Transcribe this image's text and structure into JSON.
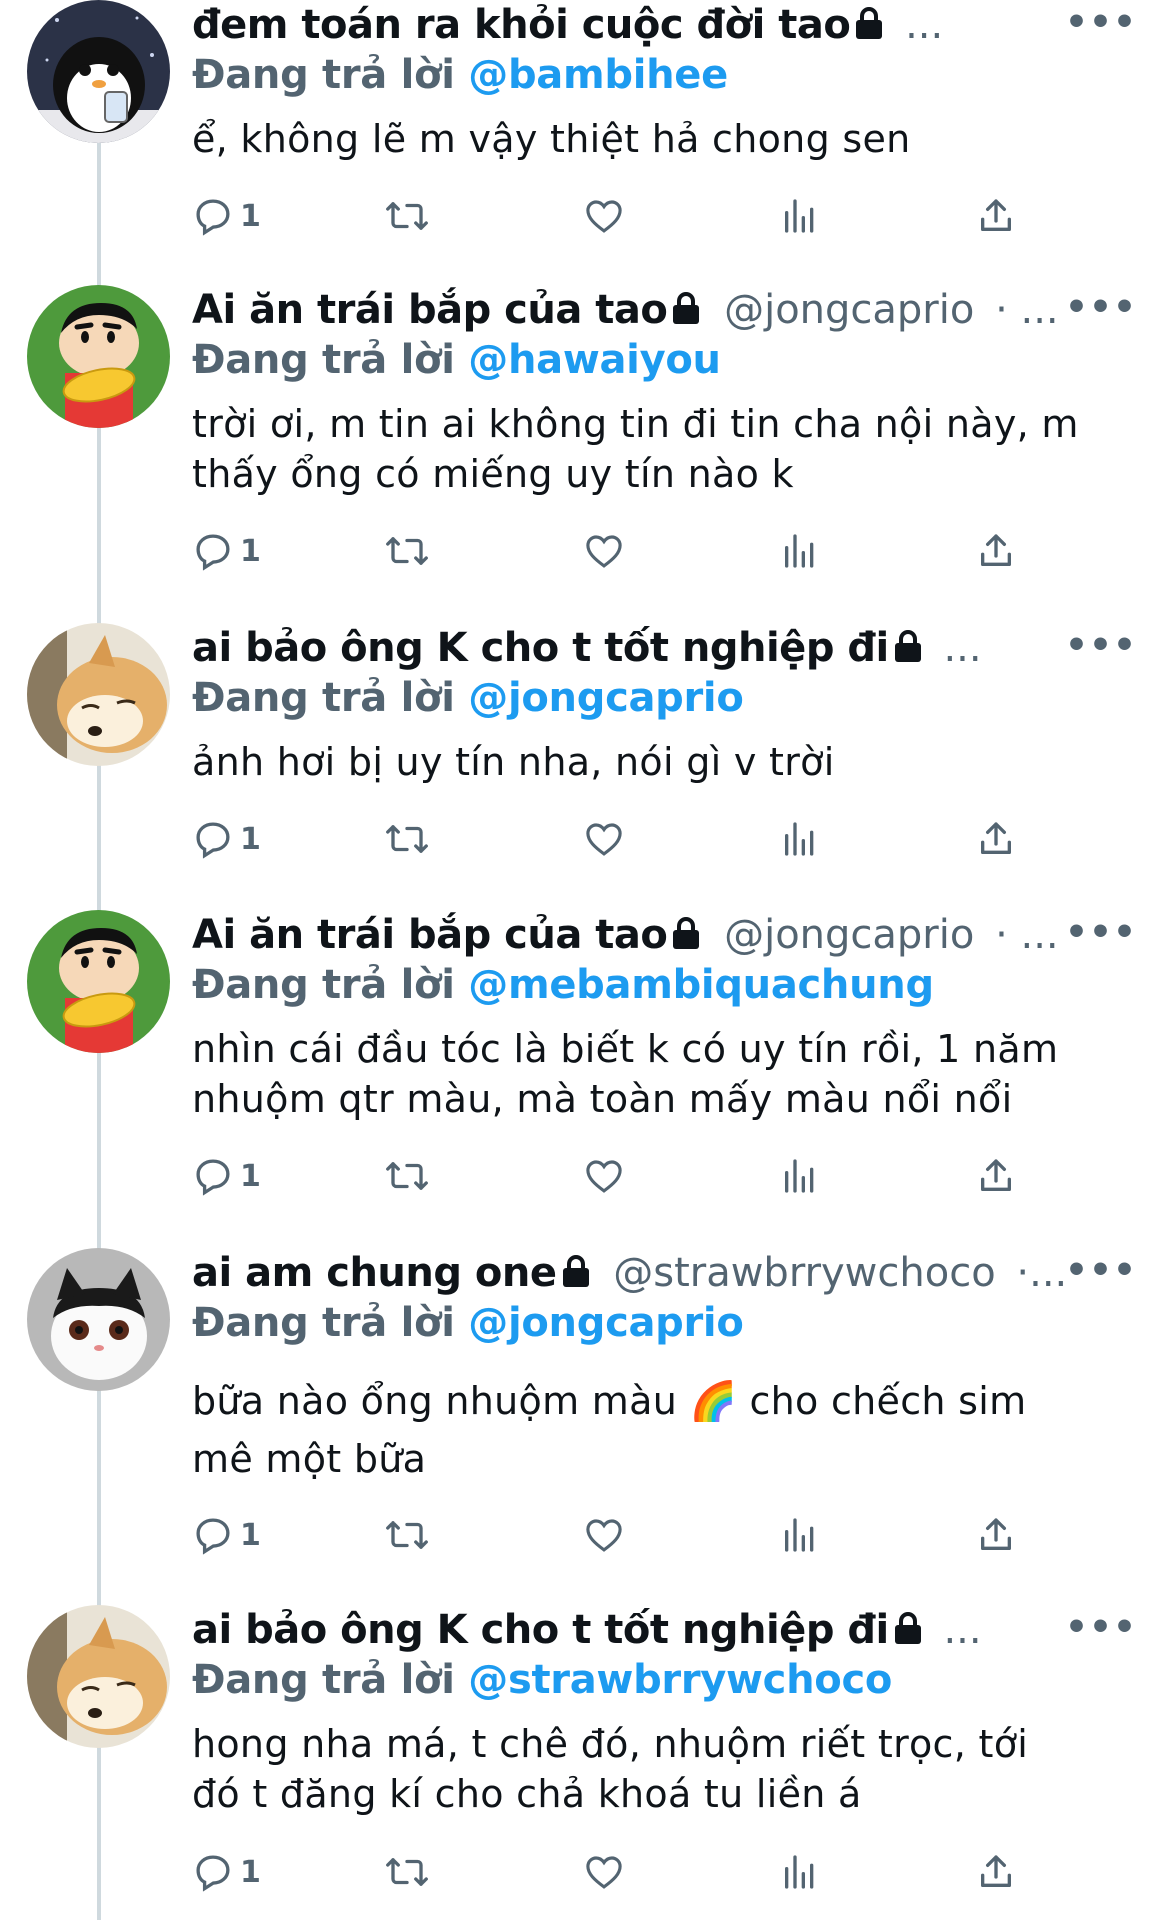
{
  "thread": {
    "tweets": [
      {
        "name": "đem toán ra khỏi cuộc đời tao",
        "handle": "",
        "trail": "...",
        "replying_prefix": "Đang trả lời",
        "replying_to": "@bambihee",
        "lines": [
          "ể, không lẽ m vậy thiệt hả chong sen"
        ],
        "reply_count": "1",
        "avatar": "penguin-avatar",
        "more_label": "•••"
      },
      {
        "name": "Ai ăn trái bắp của tao",
        "handle": "@jongcaprio",
        "trail": "· ...",
        "replying_prefix": "Đang trả lời",
        "replying_to": "@hawaiyou",
        "lines": [
          "trời ơi, m tin ai không tin đi tin cha nội này, m",
          "thấy ổng có miếng uy tín nào k"
        ],
        "reply_count": "1",
        "avatar": "shinchan-corn-avatar",
        "more_label": "•••"
      },
      {
        "name": "ai bảo ông K cho t tốt nghiệp đi",
        "handle": "",
        "trail": "...",
        "replying_prefix": "Đang trả lời",
        "replying_to": "@jongcaprio",
        "lines": [
          "ảnh hơi bị uy tín nha, nói gì v trời"
        ],
        "reply_count": "1",
        "avatar": "sleeping-dog-avatar",
        "more_label": "•••"
      },
      {
        "name": "Ai ăn trái bắp của tao",
        "handle": "@jongcaprio",
        "trail": "· ...",
        "replying_prefix": "Đang trả lời",
        "replying_to": "@mebambiquachung",
        "lines": [
          "nhìn cái đầu tóc là biết k có uy tín rồi, 1 năm",
          "nhuộm qtr màu, mà toàn mấy màu nổi nổi"
        ],
        "reply_count": "1",
        "avatar": "shinchan-corn-avatar",
        "more_label": "•••"
      },
      {
        "name": "ai am chung one",
        "handle": "@strawbrrywchoco",
        "trail": "·...",
        "replying_prefix": "Đang trả lời",
        "replying_to": "@jongcaprio",
        "lines": [
          "bữa nào ổng nhuộm màu 🌈 cho chếch sim",
          "mê một bữa"
        ],
        "reply_count": "1",
        "avatar": "cat-avatar",
        "more_label": "•••"
      },
      {
        "name": "ai bảo ông K cho t tốt nghiệp đi",
        "handle": "",
        "trail": "...",
        "replying_prefix": "Đang trả lời",
        "replying_to": "@strawbrrywchoco",
        "lines": [
          "hong nha má, t chê đó, nhuộm riết trọc, tới",
          "đó t đăng kí cho chả khoá tu liền á"
        ],
        "reply_count": "1",
        "avatar": "sleeping-dog-avatar",
        "more_label": "•••"
      }
    ]
  }
}
